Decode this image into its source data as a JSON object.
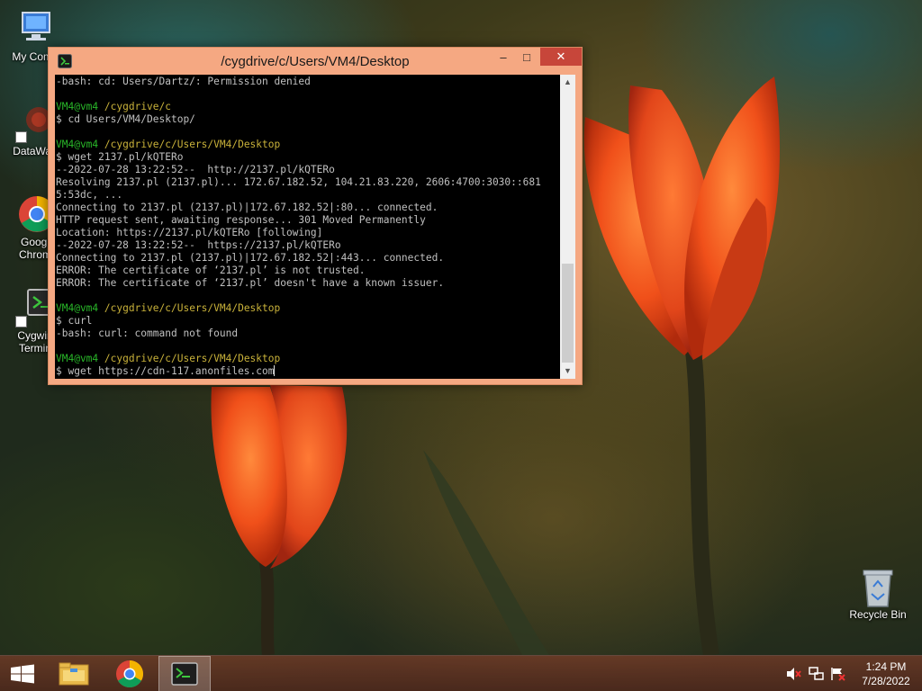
{
  "desktop": {
    "icons": [
      {
        "label_line1": "My Comp",
        "label_line2": ""
      },
      {
        "label_line1": "DataWag",
        "label_line2": ""
      },
      {
        "label_line1": "Googl",
        "label_line2": "Chrom"
      },
      {
        "label_line1": "Cygwin",
        "label_line2": "Termin"
      },
      {
        "label_line1": "Recycle Bin",
        "label_line2": ""
      }
    ]
  },
  "terminal": {
    "title": "/cygdrive/c/Users/VM4/Desktop",
    "controls": {
      "minimize": "–",
      "maximize": "□",
      "close": "✕"
    },
    "lines": [
      {
        "text": "-bash: cd: Users/Dartz/: Permission denied"
      },
      {
        "text": ""
      },
      {
        "user": "VM4@vm4",
        "path": "/cygdrive/c"
      },
      {
        "text": "$ cd Users/VM4/Desktop/"
      },
      {
        "text": ""
      },
      {
        "user": "VM4@vm4",
        "path": "/cygdrive/c/Users/VM4/Desktop"
      },
      {
        "text": "$ wget 2137.pl/kQTERo"
      },
      {
        "text": "--2022-07-28 13:22:52--  http://2137.pl/kQTERo"
      },
      {
        "text": "Resolving 2137.pl (2137.pl)... 172.67.182.52, 104.21.83.220, 2606:4700:3030::681"
      },
      {
        "text": "5:53dc, ..."
      },
      {
        "text": "Connecting to 2137.pl (2137.pl)|172.67.182.52|:80... connected."
      },
      {
        "text": "HTTP request sent, awaiting response... 301 Moved Permanently"
      },
      {
        "text": "Location: https://2137.pl/kQTERo [following]"
      },
      {
        "text": "--2022-07-28 13:22:52--  https://2137.pl/kQTERo"
      },
      {
        "text": "Connecting to 2137.pl (2137.pl)|172.67.182.52|:443... connected."
      },
      {
        "text": "ERROR: The certificate of ‘2137.pl’ is not trusted."
      },
      {
        "text": "ERROR: The certificate of ‘2137.pl’ doesn't have a known issuer."
      },
      {
        "text": ""
      },
      {
        "user": "VM4@vm4",
        "path": "/cygdrive/c/Users/VM4/Desktop"
      },
      {
        "text": "$ curl"
      },
      {
        "text": "-bash: curl: command not found"
      },
      {
        "text": ""
      },
      {
        "user": "VM4@vm4",
        "path": "/cygdrive/c/Users/VM4/Desktop"
      }
    ],
    "current_input": "$ wget https://cdn-117.anonfiles.com"
  },
  "taskbar": {
    "time": "1:24 PM",
    "date": "7/28/2022"
  },
  "colors": {
    "prompt_user": "#29b829",
    "prompt_path": "#c9b23a",
    "title_bar": "#f5a882",
    "close_button": "#c7463a"
  }
}
